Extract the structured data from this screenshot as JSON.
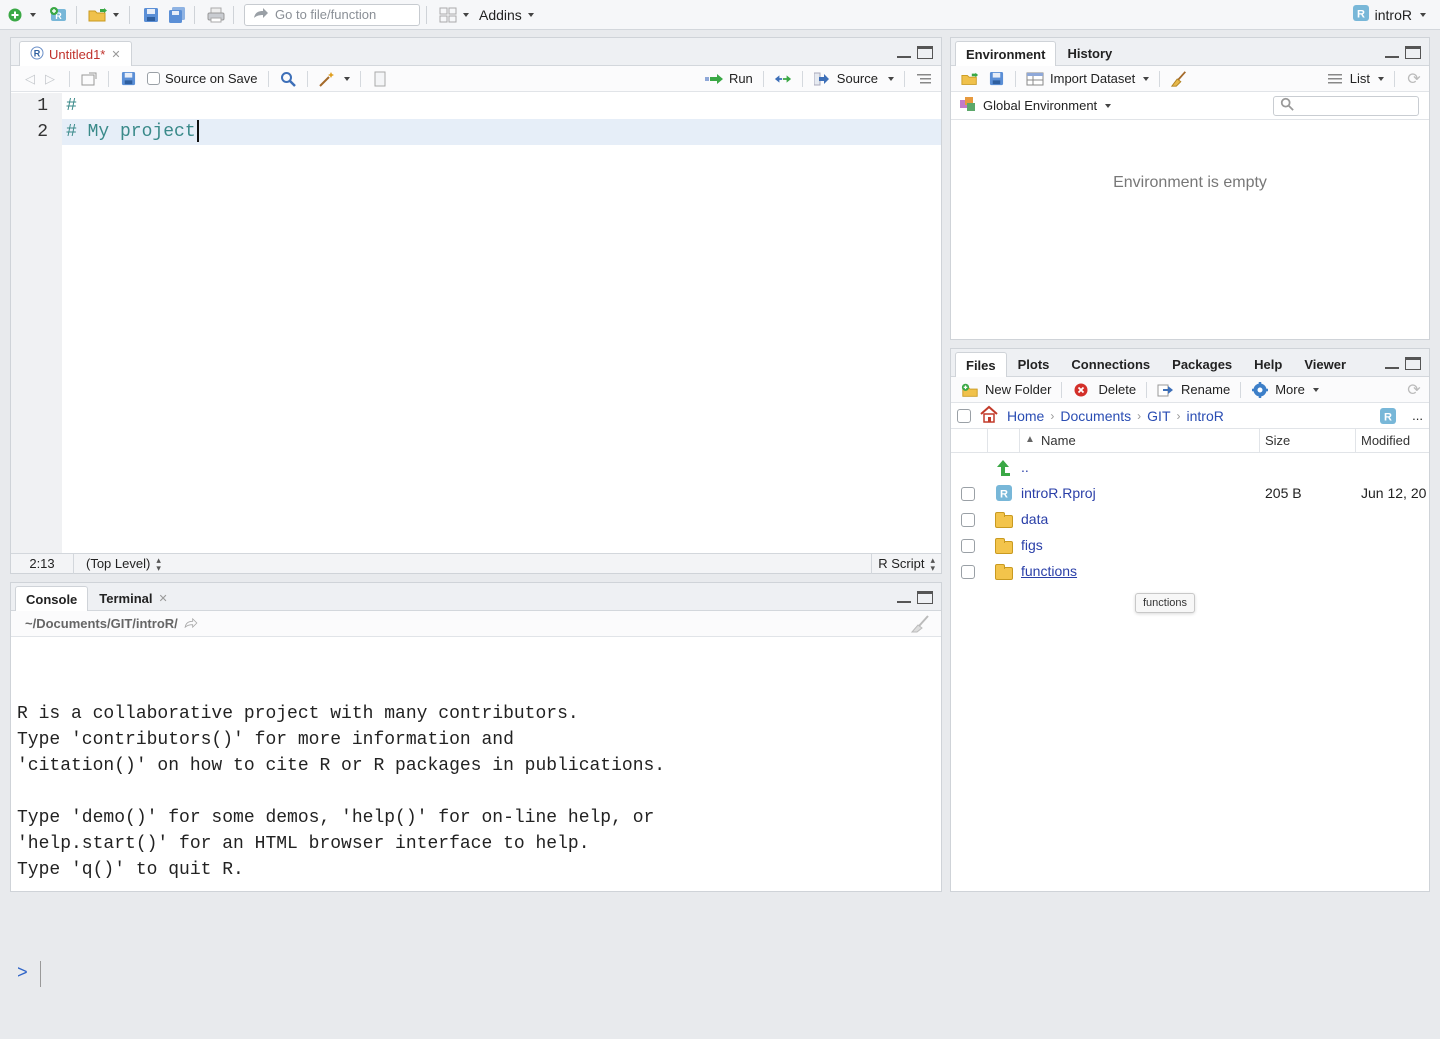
{
  "topbar": {
    "goto_placeholder": "Go to file/function",
    "addins_label": "Addins",
    "project_label": "introR"
  },
  "editor": {
    "tab_title": "Untitled1*",
    "source_on_save_label": "Source on Save",
    "run_label": "Run",
    "source_label": "Source",
    "lines": [
      {
        "num": "1",
        "text": "#"
      },
      {
        "num": "2",
        "text": "# My project"
      }
    ],
    "status": {
      "position": "2:13",
      "scope": "(Top Level)",
      "filetype": "R Script"
    }
  },
  "console": {
    "tabs": [
      "Console",
      "Terminal"
    ],
    "path": "~/Documents/GIT/introR/",
    "output": "R is a collaborative project with many contributors.\nType 'contributors()' for more information and\n'citation()' on how to cite R or R packages in publications.\n\nType 'demo()' for some demos, 'help()' for on-line help, or\n'help.start()' for an HTML browser interface to help.\nType 'q()' to quit R.",
    "prompt": ">"
  },
  "environment": {
    "tabs": [
      "Environment",
      "History"
    ],
    "import_label": "Import Dataset",
    "list_label": "List",
    "scope_label": "Global Environment",
    "empty_message": "Environment is empty"
  },
  "files": {
    "tabs": [
      "Files",
      "Plots",
      "Connections",
      "Packages",
      "Help",
      "Viewer"
    ],
    "toolbar": {
      "new_folder": "New Folder",
      "delete": "Delete",
      "rename": "Rename",
      "more": "More"
    },
    "breadcrumb": [
      "Home",
      "Documents",
      "GIT",
      "introR"
    ],
    "more_dots": "...",
    "columns": {
      "name": "Name",
      "size": "Size",
      "modified": "Modified"
    },
    "parent": "..",
    "rows": [
      {
        "name": "introR.Rproj",
        "size": "205 B",
        "modified": "Jun 12, 20",
        "type": "rproj"
      },
      {
        "name": "data",
        "size": "",
        "modified": "",
        "type": "folder"
      },
      {
        "name": "figs",
        "size": "",
        "modified": "",
        "type": "folder"
      },
      {
        "name": "functions",
        "size": "",
        "modified": "",
        "type": "folder"
      }
    ],
    "tooltip": "functions"
  }
}
